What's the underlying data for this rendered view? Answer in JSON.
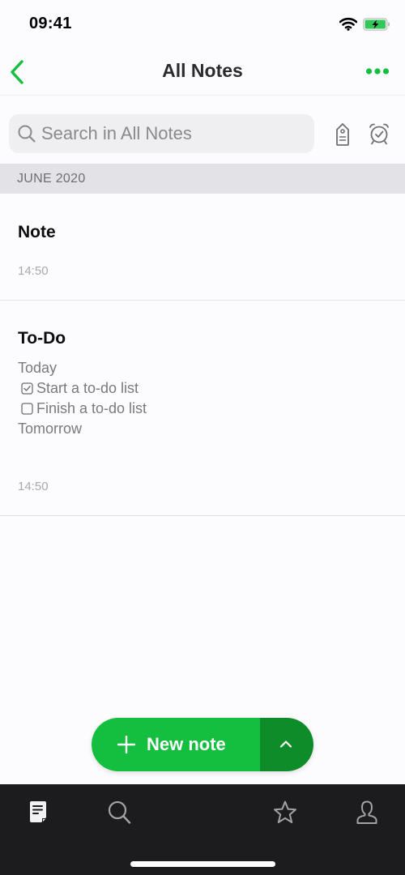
{
  "status_bar": {
    "time": "09:41",
    "icons": [
      "wifi-icon",
      "battery-charging-icon"
    ],
    "battery_color": "#34c759"
  },
  "nav": {
    "title": "All Notes",
    "back_icon": "chevron-left-icon",
    "more_icon": "more-dots-icon",
    "accent": "#14bf3f"
  },
  "search": {
    "placeholder": "Search in All Notes",
    "icon": "search-icon",
    "actions": [
      "tag-icon",
      "reminder-alarm-icon"
    ]
  },
  "section": {
    "label": "JUNE 2020"
  },
  "notes": [
    {
      "title": "Note",
      "time": "14:50"
    },
    {
      "title": "To-Do",
      "lines": [
        {
          "type": "text",
          "text": "Today"
        },
        {
          "type": "todo",
          "checked": true,
          "text": "Start a to-do list"
        },
        {
          "type": "todo",
          "checked": false,
          "text": "Finish a to-do list"
        },
        {
          "type": "text",
          "text": "Tomorrow"
        }
      ],
      "time": "14:50"
    }
  ],
  "fab": {
    "label": "New note",
    "icon": "plus-icon",
    "toggle_icon": "chevron-up-icon",
    "color": "#14bf3f",
    "toggle_color": "#0f8c2a"
  },
  "tab_bar": {
    "tabs": [
      {
        "name": "notes",
        "icon": "notes-icon",
        "active": true
      },
      {
        "name": "search",
        "icon": "search-icon",
        "active": false
      },
      {
        "name": "shortcuts",
        "icon": "star-icon",
        "active": false
      },
      {
        "name": "account",
        "icon": "account-icon",
        "active": false
      }
    ]
  }
}
